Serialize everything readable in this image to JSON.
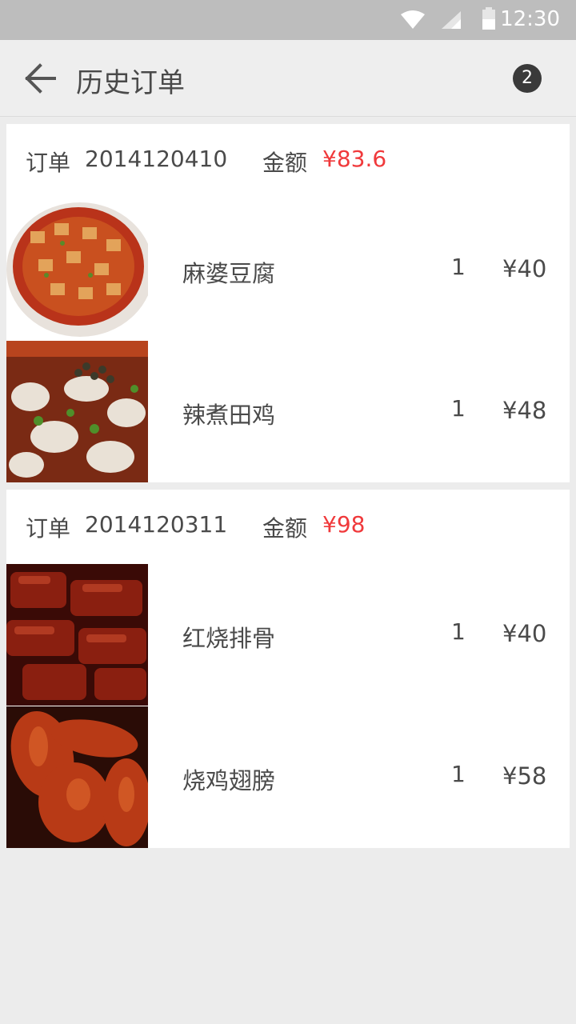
{
  "status_bar": {
    "time": "12:30",
    "icons": [
      "wifi-icon",
      "signal-icon",
      "battery-icon"
    ]
  },
  "app_bar": {
    "back_icon": "arrow-left-icon",
    "title": "历史订单",
    "badge_count": "2"
  },
  "labels": {
    "order": "订单",
    "amount": "金额"
  },
  "orders": [
    {
      "order_no": "2014120410",
      "amount": "¥83.6",
      "items": [
        {
          "name": "麻婆豆腐",
          "qty": "1",
          "price": "¥40",
          "image": "mapo-tofu-image"
        },
        {
          "name": "辣煮田鸡",
          "qty": "1",
          "price": "¥48",
          "image": "spicy-frog-image"
        }
      ]
    },
    {
      "order_no": "2014120311",
      "amount": "¥98",
      "items": [
        {
          "name": "红烧排骨",
          "qty": "1",
          "price": "¥40",
          "image": "braised-ribs-image"
        },
        {
          "name": "烧鸡翅膀",
          "qty": "1",
          "price": "¥58",
          "image": "roast-chicken-wings-image"
        }
      ]
    }
  ],
  "colors": {
    "accent_price": "#f0393b",
    "status_bar": "#bdbdbd",
    "background": "#ececec"
  }
}
